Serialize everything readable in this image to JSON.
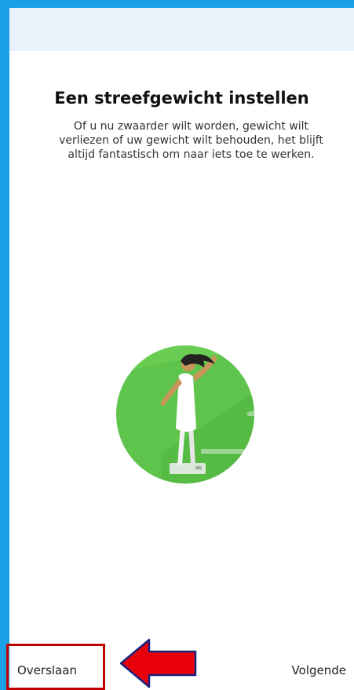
{
  "onboarding": {
    "title": "Een streefgewicht instellen",
    "description": "Of u nu zwaarder wilt worden, gewicht wilt verliezen of uw gewicht wilt behouden, het blijft altijd fantastisch om naar iets toe te werken.",
    "illustration_icon": "person-on-scale-icon"
  },
  "footer": {
    "skip_label": "Overslaan",
    "next_label": "Volgende"
  },
  "annotation": {
    "highlight_color": "#c00000",
    "arrow_fill": "#e8000b",
    "arrow_stroke": "#1a237e"
  },
  "colors": {
    "frame": "#1aa0e6",
    "top_bar": "#e9f1fa",
    "circle_green": "#5fc44b"
  }
}
